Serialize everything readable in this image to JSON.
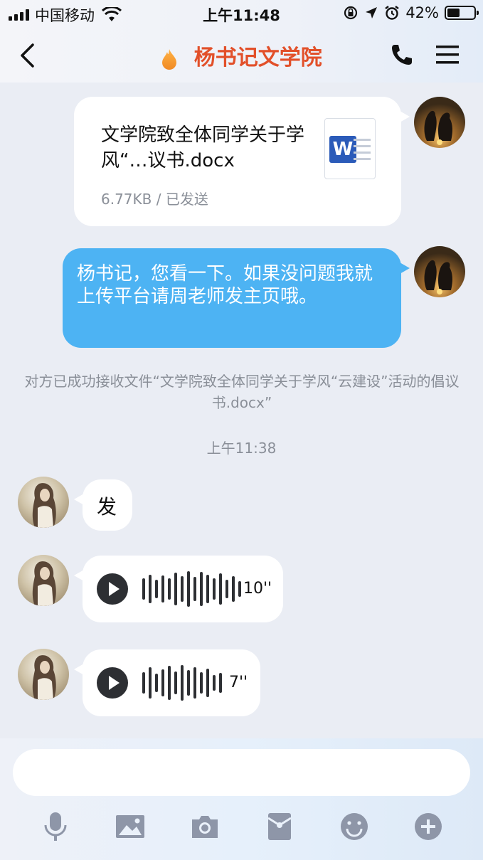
{
  "status": {
    "carrier": "中国移动",
    "time": "上午11:48",
    "battery": "42%"
  },
  "nav": {
    "title": "杨书记文学院"
  },
  "messages": {
    "file": {
      "name": "文学院致全体同学关于学风“…议书.docx",
      "meta": "6.77KB / 已发送",
      "icon": "word-icon"
    },
    "text1": "杨书记，您看一下。如果没问题我就上传平台请周老师发主页哦。",
    "notice": "对方已成功接收文件“文学院致全体同学关于学风“云建设”活动的倡议书.docx”",
    "time": "上午11:38",
    "reply": "发",
    "voice1": "10''",
    "voice2": "7''"
  },
  "input": {
    "placeholder": ""
  },
  "toolbar": {
    "icons": [
      "microphone-icon",
      "image-icon",
      "camera-icon",
      "red-packet-icon",
      "emoji-icon",
      "plus-icon"
    ]
  },
  "colors": {
    "accent": "#e2502a",
    "blue_bubble": "#4db3f3",
    "icon_gray": "#8e96a8"
  }
}
